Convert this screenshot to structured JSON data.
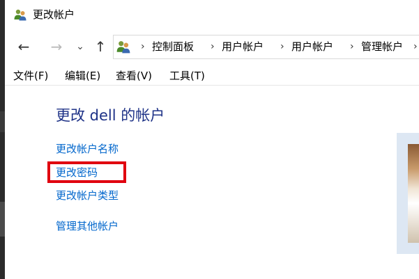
{
  "window": {
    "title": "更改帐户",
    "title_icon": "user-accounts-icon"
  },
  "nav": {
    "back_icon": "back-arrow-icon",
    "back_glyph": "←",
    "forward_icon": "forward-arrow-icon",
    "forward_glyph": "→",
    "recent_icon": "chevron-down-icon",
    "recent_glyph": "⌄",
    "up_icon": "up-arrow-icon",
    "up_glyph": "↑",
    "address_icon": "user-accounts-icon",
    "separator": "›",
    "breadcrumbs": [
      "控制面板",
      "用户帐户",
      "用户帐户",
      "管理帐户"
    ]
  },
  "menu": {
    "items": [
      "文件(F)",
      "编辑(E)",
      "查看(V)",
      "工具(T)"
    ]
  },
  "content": {
    "heading": "更改 dell 的帐户",
    "links": [
      "更改帐户名称",
      "更改密码",
      "更改帐户类型",
      "管理其他帐户"
    ],
    "highlighted_link": "更改密码",
    "highlight_color": "#e0000f",
    "link_color": "#0066cc",
    "heading_color": "#1e3287"
  }
}
